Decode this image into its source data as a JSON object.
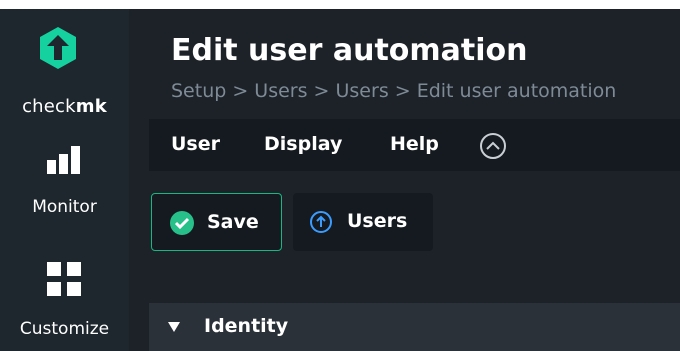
{
  "app": {
    "logo_part1": "check",
    "logo_part2": "mk"
  },
  "sidebar": {
    "items": [
      {
        "label": "Monitor",
        "icon": "bar-chart-icon"
      },
      {
        "label": "Customize",
        "icon": "grid-icon"
      }
    ]
  },
  "header": {
    "title": "Edit user automation",
    "breadcrumb": "Setup > Users > Users > Edit user automation"
  },
  "menu": {
    "items": [
      "User",
      "Display",
      "Help"
    ]
  },
  "toolbar": {
    "save_label": "Save",
    "users_label": "Users"
  },
  "section": {
    "identity_title": "Identity"
  },
  "colors": {
    "accent": "#15d1a0",
    "save_check": "#27c08a",
    "users_icon": "#3b9cff",
    "background": "#1c2228",
    "sidebar": "#1e262e"
  }
}
